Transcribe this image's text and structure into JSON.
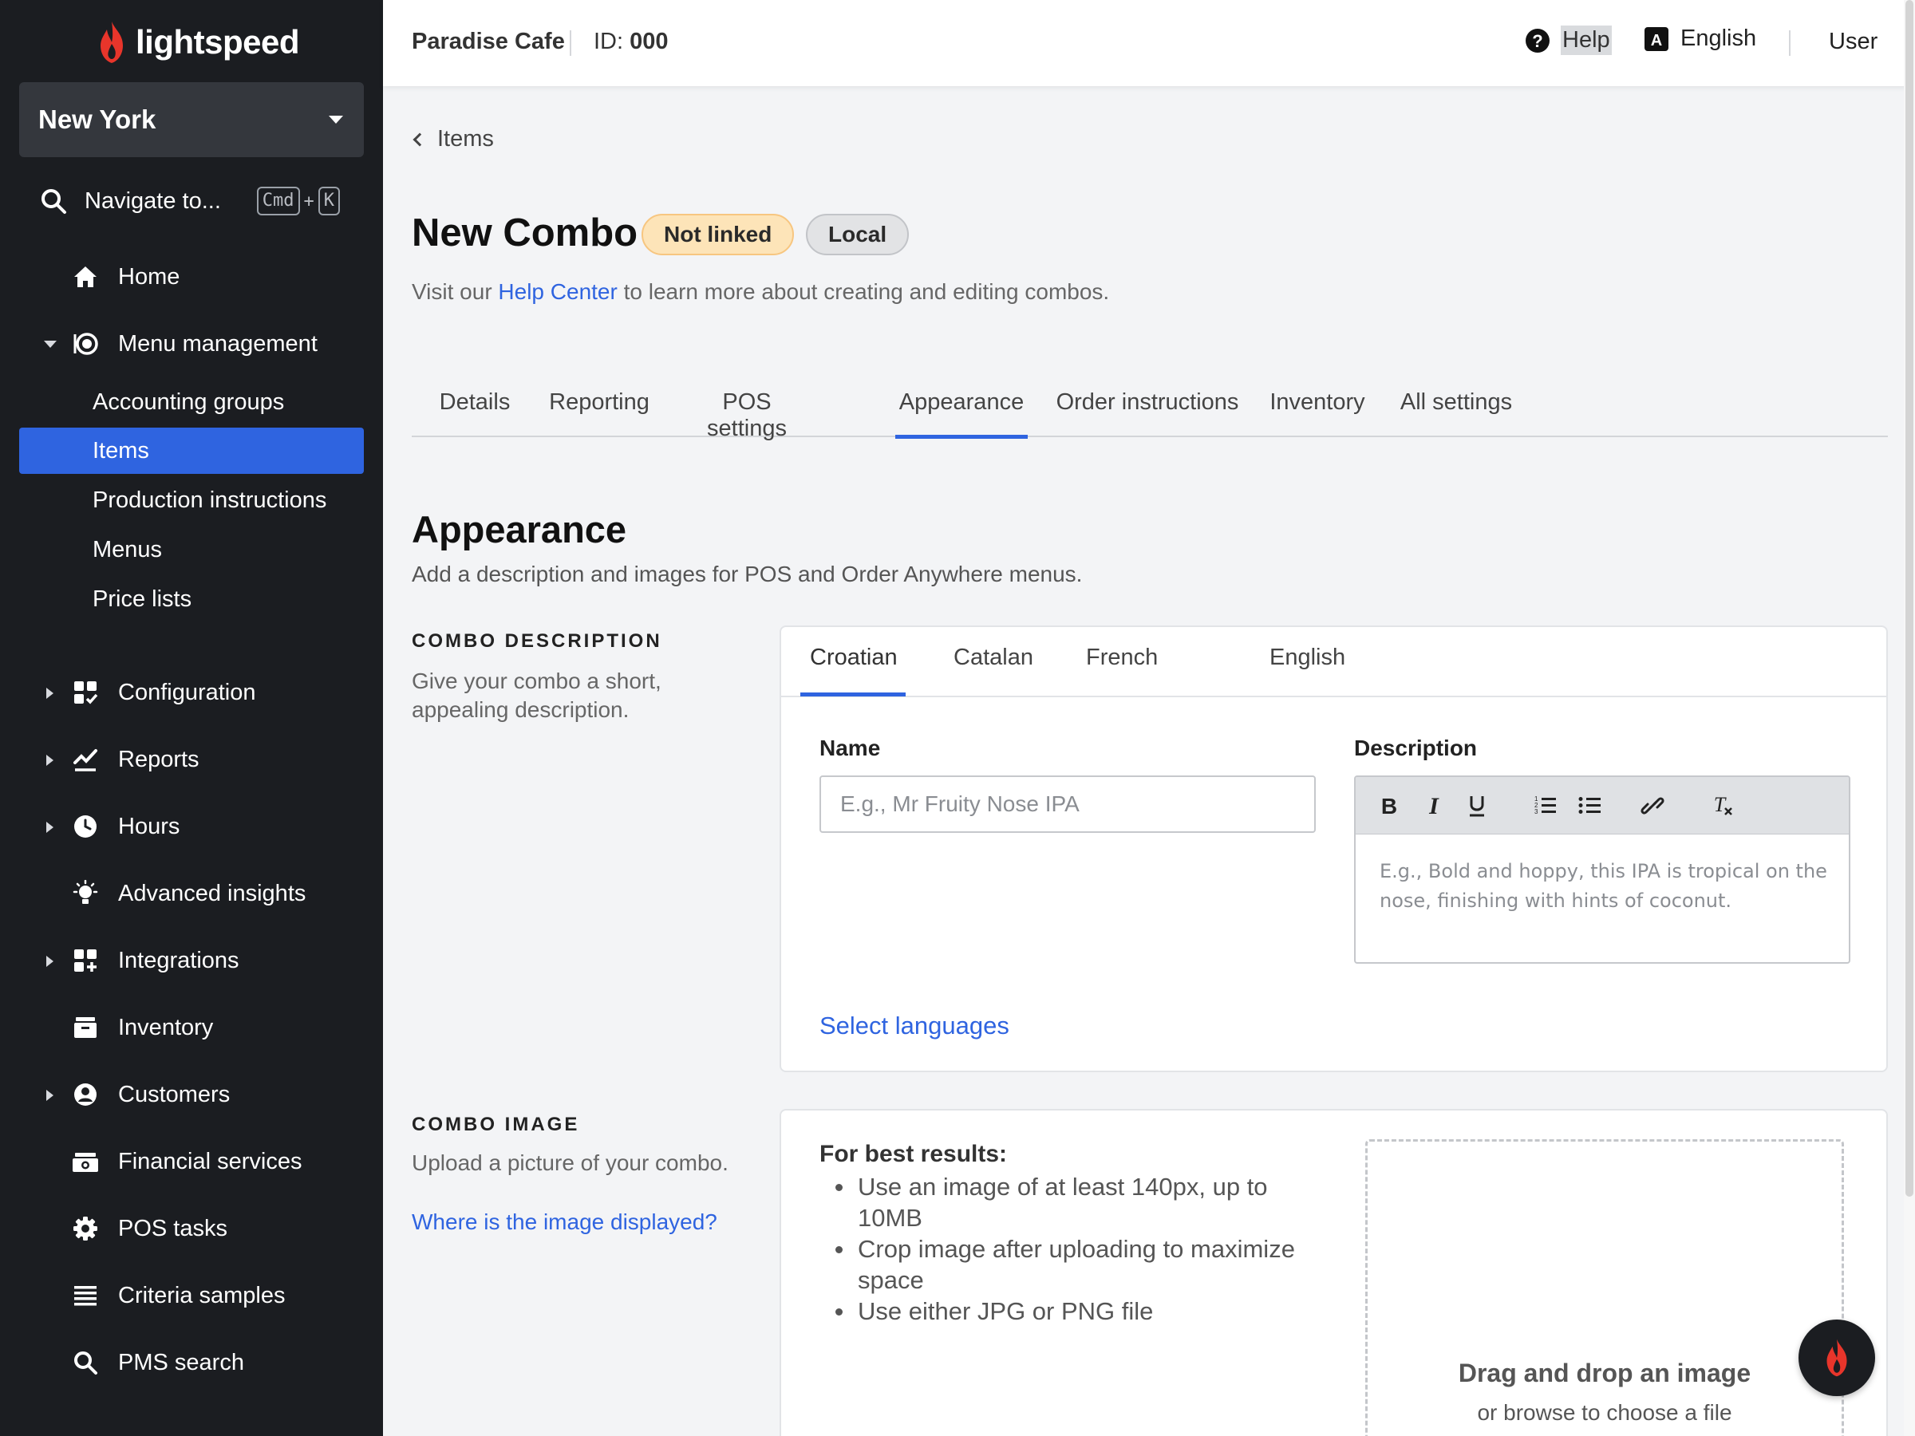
{
  "brand": {
    "name": "lightspeed",
    "color": "#e8352b"
  },
  "sidebar": {
    "location": "New York",
    "search": {
      "label": "Navigate to...",
      "key1": "Cmd",
      "plus": "+",
      "key2": "K"
    },
    "nav": [
      {
        "label": "Home",
        "icon": "home-icon"
      },
      {
        "label": "Menu management",
        "icon": "menu-management-icon",
        "expanded": true
      },
      {
        "label": "Configuration",
        "icon": "configuration-icon"
      },
      {
        "label": "Reports",
        "icon": "reports-icon"
      },
      {
        "label": "Hours",
        "icon": "clock-icon"
      },
      {
        "label": "Advanced insights",
        "icon": "lightbulb-icon"
      },
      {
        "label": "Integrations",
        "icon": "integrations-icon"
      },
      {
        "label": "Inventory",
        "icon": "inventory-icon"
      },
      {
        "label": "Customers",
        "icon": "customer-icon"
      },
      {
        "label": "Financial services",
        "icon": "money-icon"
      },
      {
        "label": "POS tasks",
        "icon": "gear-icon"
      },
      {
        "label": "Criteria samples",
        "icon": "list-icon"
      },
      {
        "label": "PMS search",
        "icon": "search-icon"
      }
    ],
    "menu_sub": [
      {
        "label": "Accounting groups"
      },
      {
        "label": "Items",
        "active": true
      },
      {
        "label": "Production instructions"
      },
      {
        "label": "Menus"
      },
      {
        "label": "Price lists"
      }
    ]
  },
  "topbar": {
    "store": "Paradise Cafe",
    "id_label": "ID:",
    "id_value": "000",
    "help": "Help",
    "language": "English",
    "user": "User"
  },
  "page": {
    "back": "Items",
    "title": "New Combo",
    "badge_linked": "Not linked",
    "badge_local": "Local",
    "subtitle_pre": "Visit our",
    "subtitle_link": "Help Center",
    "subtitle_post": "to learn more about creating and editing combos.",
    "tabs": [
      "Details",
      "Reporting",
      "POS settings",
      "Appearance",
      "Order instructions",
      "Inventory",
      "All settings"
    ],
    "active_tab": "Appearance",
    "section_title": "Appearance",
    "section_sub": "Add a description and images for POS and Order Anywhere menus."
  },
  "combo_description": {
    "heading": "COMBO DESCRIPTION",
    "desc": "Give your combo a short, appealing description.",
    "languages": [
      "Croatian",
      "Catalan",
      "French",
      "English"
    ],
    "active_language": "Croatian",
    "name_label": "Name",
    "name_placeholder": "E.g., Mr Fruity Nose IPA",
    "description_label": "Description",
    "description_placeholder": "E.g., Bold and hoppy, this IPA is tropical on the nose, finishing with hints of coconut.",
    "select_languages": "Select languages"
  },
  "combo_image": {
    "heading": "COMBO IMAGE",
    "desc": "Upload a picture of your combo.",
    "link": "Where is the image displayed?",
    "best_title": "For best results:",
    "tips": [
      "Use an image of at least 140px, up to 10MB",
      "Crop image after uploading to maximize space",
      "Use either JPG or PNG file"
    ],
    "drop_title": "Drag and drop an image",
    "drop_sub": "or browse to choose a file"
  },
  "colors": {
    "accent": "#2f64e0",
    "sidebar_bg": "#1b1d21",
    "badge_warning": "#fde4b8"
  }
}
